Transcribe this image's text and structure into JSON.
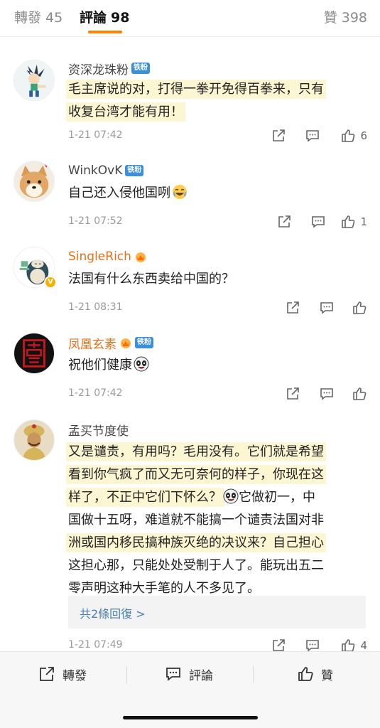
{
  "tabs": {
    "repost": {
      "label": "轉發",
      "count": "45"
    },
    "comments": {
      "label": "評論",
      "count": "98"
    },
    "likes": {
      "label": "贊",
      "count": "398"
    }
  },
  "colors": {
    "accent": "#ff8200",
    "fan_badge": "#3c8fd9",
    "highlight": "#fdf6d3",
    "link": "#4a7fb5"
  },
  "comments": [
    {
      "username": "资深龙珠粉",
      "badge": "铁粉",
      "text_lines": [
        "毛主席说的对，打得一拳开免得百拳来，只有",
        "收复台湾才能有用！"
      ],
      "time": "1-21 07:42",
      "likes": "6",
      "avatar_icon": "cartoon-character-avatar"
    },
    {
      "username": "WinkOvK",
      "badge": "铁粉",
      "text": "自己还入侵他国咧",
      "emoji": "crying-laugh-emoji",
      "time": "1-21 07:52",
      "likes": "1",
      "avatar_icon": "shiba-dog-avatar"
    },
    {
      "username": "SingleRich",
      "text": "法国有什么东西卖给中国的？",
      "time": "1-21 08:31",
      "likes": "",
      "avatar_icon": "snorlax-avatar",
      "verified_icon": "verified-v-icon"
    },
    {
      "username": "凤凰玄素",
      "badge": "铁粉",
      "text": "祝他们健康",
      "emoji": "panda-emoji",
      "time": "1-21 07:42",
      "likes": "",
      "avatar_icon": "red-seal-avatar"
    },
    {
      "username": "孟买节度使",
      "text_lines": [
        "又是谴责，有用吗？毛用没有。它们就是希望",
        "看到你气疯了而又无可奈何的样子，你现在这",
        "样了，不正中它们下怀么？",
        "它做初一，中",
        "国做十五呀，难道就不能搞一个谴责法国对非",
        "洲或国内移民搞种族灭绝的决议来？自己担心",
        "这担心那，只能处处受制于人了。能玩出五二",
        "零声明这种大手笔的人不多见了。"
      ],
      "replies_link": "共2條回復 >",
      "time": "1-21 07:49",
      "likes": "4",
      "avatar_icon": "indian-emperor-avatar"
    }
  ],
  "bottom_bar": {
    "repost": "轉發",
    "comment": "評論",
    "like": "贊"
  }
}
